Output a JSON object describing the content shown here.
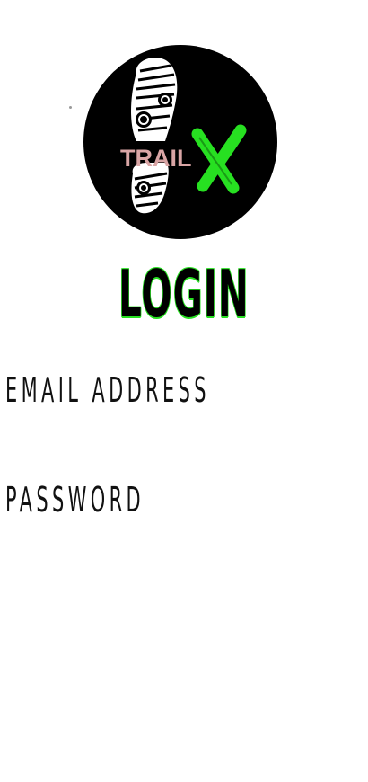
{
  "app": {
    "logo": {
      "brand_text": "TRAIL",
      "brand_mark": "X",
      "icon": "boot-print-icon",
      "colors": {
        "circle": "#000000",
        "brand_text": "#d9a5a5",
        "brand_mark": "#27e021",
        "sole": "#ffffff"
      }
    }
  },
  "header": {
    "title": "LOGIN",
    "title_outline_color": "#27e021"
  },
  "form": {
    "email": {
      "label": "EMAIL ADDRESS",
      "value": "",
      "placeholder": ""
    },
    "password": {
      "label": "PASSWORD",
      "value": "",
      "placeholder": ""
    }
  }
}
